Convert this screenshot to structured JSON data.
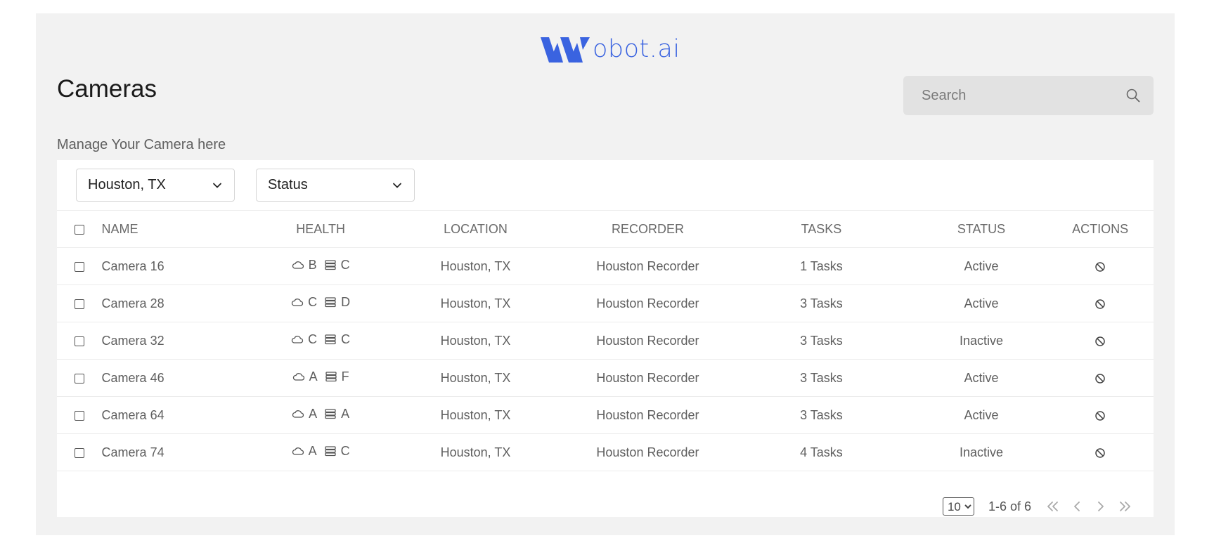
{
  "brand": {
    "logo_text": "obot.ai",
    "color": "#3a63e0"
  },
  "header": {
    "title": "Cameras",
    "subtitle": "Manage Your Camera here"
  },
  "search": {
    "placeholder": "Search",
    "icon": "search-icon"
  },
  "filters": {
    "location": "Houston, TX",
    "status": "Status"
  },
  "table": {
    "columns": [
      "NAME",
      "HEALTH",
      "LOCATION",
      "RECORDER",
      "TASKS",
      "STATUS",
      "ACTIONS"
    ],
    "rows": [
      {
        "name": "Camera 16",
        "cloud": "B",
        "storage": "C",
        "location": "Houston, TX",
        "recorder": "Houston Recorder",
        "tasks": "1 Tasks",
        "status": "Active"
      },
      {
        "name": "Camera 28",
        "cloud": "C",
        "storage": "D",
        "location": "Houston, TX",
        "recorder": "Houston Recorder",
        "tasks": "3 Tasks",
        "status": "Active"
      },
      {
        "name": "Camera 32",
        "cloud": "C",
        "storage": "C",
        "location": "Houston, TX",
        "recorder": "Houston Recorder",
        "tasks": "3 Tasks",
        "status": "Inactive"
      },
      {
        "name": "Camera 46",
        "cloud": "A",
        "storage": "F",
        "location": "Houston, TX",
        "recorder": "Houston Recorder",
        "tasks": "3 Tasks",
        "status": "Active"
      },
      {
        "name": "Camera 64",
        "cloud": "A",
        "storage": "A",
        "location": "Houston, TX",
        "recorder": "Houston Recorder",
        "tasks": "3 Tasks",
        "status": "Active"
      },
      {
        "name": "Camera 74",
        "cloud": "A",
        "storage": "C",
        "location": "Houston, TX",
        "recorder": "Houston Recorder",
        "tasks": "4 Tasks",
        "status": "Inactive"
      }
    ]
  },
  "pagination": {
    "per_page": "10",
    "range": "1-6 of 6"
  }
}
